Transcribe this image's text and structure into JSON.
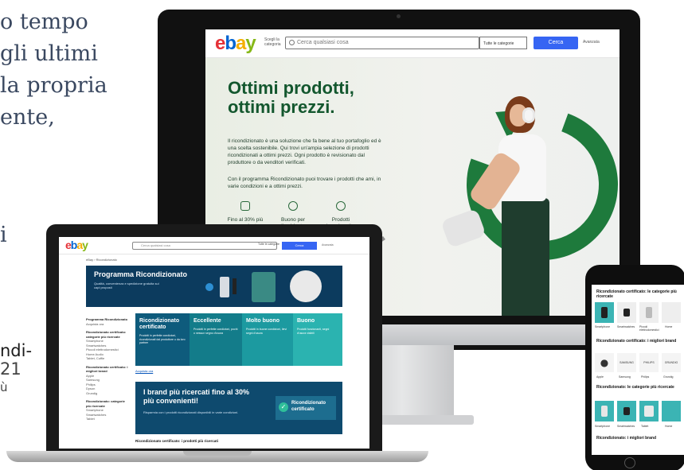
{
  "magazine": {
    "lines": [
      "o tempo",
      "gli ultimi",
      "la propria",
      "ente,"
    ],
    "single_letter": "i",
    "bottom": [
      "ndi-",
      "21",
      "ù"
    ]
  },
  "imac_page": {
    "logo": [
      "e",
      "b",
      "a",
      "y"
    ],
    "browse_label": "Scegli la categoria",
    "search_placeholder": "Cerca qualsiasi cosa",
    "category_select": "Tutte le categorie",
    "search_button": "Cerca",
    "advanced_link": "Avanzata",
    "hero_title": "Ottimi prodotti, ottimi prezzi.",
    "hero_paragraph_1": "Il ricondizionato è una soluzione che fa bene al tuo portafoglio ed è una scelta sostenibile. Qui trovi un'ampia selezione di prodotti ricondizionati a ottimi prezzi. Ogni prodotto è revisionato dal produttore o da venditori verificati.",
    "hero_paragraph_2": "Con il programma Ricondizionato puoi trovare i prodotti che ami, in varie condizioni e a ottimi prezzi.",
    "benefits": [
      {
        "label": "Fino al 30% più conveniente rispetto al nuovo",
        "icon": "calendar-icon"
      },
      {
        "label": "Buono per l'ambiente",
        "icon": "leaf-icon"
      },
      {
        "label": "Prodotti ispezionati e testati",
        "icon": "check-circle-icon"
      }
    ]
  },
  "laptop_page": {
    "search_placeholder": "Cerca qualsiasi cosa",
    "category_select": "Tutte le categorie",
    "search_button": "Cerca",
    "advanced_link": "Avanzata",
    "breadcrumb": "eBay › Ricondizionato",
    "banner_title": "Programma Ricondizionato",
    "banner_sub": "Qualità, convenienza e spedizione gratuita sui capi proposti",
    "sidebar": [
      {
        "type": "h",
        "text": "Programma Ricondizionato"
      },
      {
        "type": "i",
        "text": "Acquista ora"
      },
      {
        "type": "h",
        "text": "Ricondizionato certificato: categorie più ricercate"
      },
      {
        "type": "i",
        "text": "Smartphone"
      },
      {
        "type": "i",
        "text": "Smartwatches"
      },
      {
        "type": "i",
        "text": "Piccoli elettrodomestici"
      },
      {
        "type": "i",
        "text": "Home Audio"
      },
      {
        "type": "i",
        "text": "Tablet, Cuffie"
      },
      {
        "type": "h",
        "text": "Ricondizionato certificato: i migliori brand"
      },
      {
        "type": "i",
        "text": "Apple"
      },
      {
        "type": "i",
        "text": "Samsung"
      },
      {
        "type": "i",
        "text": "Philips"
      },
      {
        "type": "i",
        "text": "Dyson"
      },
      {
        "type": "i",
        "text": "Grundig"
      },
      {
        "type": "h",
        "text": "Ricondizionato: categorie più ricercate"
      },
      {
        "type": "i",
        "text": "Smartphone"
      },
      {
        "type": "i",
        "text": "Smartwatches"
      },
      {
        "type": "i",
        "text": "Tablet"
      }
    ],
    "conditions": [
      {
        "title": "Ricondizionato certificato",
        "desc": "Prodotti in perfette condizioni, ricondizionati dal produttore o da loro partner",
        "color": "#0e5b7c"
      },
      {
        "title": "Eccellente",
        "desc": "Prodotti in perfette condizioni, pochi o nessun segno d'usura",
        "color": "#137c8a"
      },
      {
        "title": "Molto buono",
        "desc": "Prodotti in buone condizioni, lievi segni d'usura",
        "color": "#1c9aa0"
      },
      {
        "title": "Buono",
        "desc": "Prodotti funzionanti, segni d'usura visibili",
        "color": "#2bb3b0"
      }
    ],
    "link": "Acquista ora",
    "promo_title": "I brand più ricercati fino al 30% più convenienti!",
    "promo_sub": "Risparmia con i prodotti ricondizionati disponibili in varie condizioni.",
    "promo_badge": "Ricondizionato certificato",
    "bottom_heading": "Ricondizionato certificato: i prodotti più ricercati"
  },
  "phone_page": {
    "heading_1": "Ricondizionato certificato: le categorie più ricercate",
    "categories_1": [
      "Smartphone",
      "Smartwatches",
      "Piccoli elettrodomestici",
      "Home"
    ],
    "heading_2": "Ricondizionato certificato: i migliori brand",
    "brands": [
      "Apple",
      "Samsung",
      "Philips",
      "Grundig"
    ],
    "brand_logos": [
      "",
      "SAMSUNG",
      "PHILIPS",
      "GRUNDIG"
    ],
    "heading_3": "Ricondizionato: le categorie più ricercate",
    "categories_2": [
      "Smartphone",
      "Smartwatches",
      "Tablet",
      "Home"
    ],
    "heading_4": "Ricondizionato: i migliori brand"
  },
  "colors": {
    "hero_green": "#13572e",
    "recycle_green": "#1e7a3c",
    "ebay_blue_button": "#3665f3",
    "banner_navy": "#0c3b5e",
    "teal_tile": "#3bb4b4"
  }
}
